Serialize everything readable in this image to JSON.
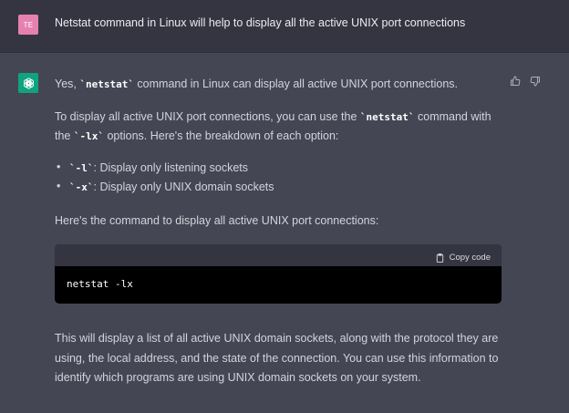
{
  "user_message": {
    "avatar_initials": "TE",
    "text": "Netstat command in Linux will help to display all the active UNIX port connections"
  },
  "assistant": {
    "p1_before": "Yes, ",
    "p1_code": "`netstat`",
    "p1_after": " command in Linux can display all active UNIX port connections.",
    "p2_before": "To display all active UNIX port connections, you can use the ",
    "p2_code1": "`netstat`",
    "p2_mid": " command with the ",
    "p2_code2": "`-lx`",
    "p2_after": " options. Here's the breakdown of each option:",
    "options": [
      {
        "code": "`-l`",
        "text": ": Display only listening sockets"
      },
      {
        "code": "`-x`",
        "text": ": Display only UNIX domain sockets"
      }
    ],
    "p3": "Here's the command to display all active UNIX port connections:",
    "code_block": {
      "copy_label": "Copy code",
      "code": "netstat -lx"
    },
    "p4": "This will display a list of all active UNIX domain sockets, along with the protocol they are using, the local address, and the state of the connection. You can use this information to identify which programs are using UNIX domain sockets on your system."
  },
  "colors": {
    "user_bg": "#343541",
    "assistant_bg": "#444654",
    "user_avatar": "#e580b0",
    "bot_avatar": "#10a37f",
    "code_bg": "#000000"
  },
  "icons": [
    "openai-logo-icon",
    "thumbs-up-icon",
    "thumbs-down-icon",
    "clipboard-icon"
  ]
}
